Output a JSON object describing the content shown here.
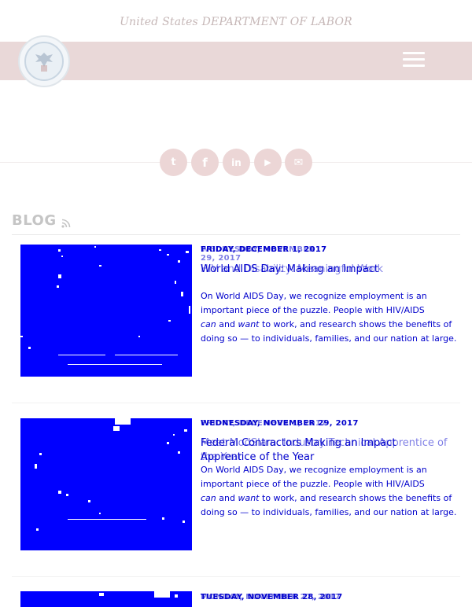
{
  "header": {
    "agency_text": "United States DEPARTMENT OF LABOR"
  },
  "social": [
    {
      "icon": "twitter-icon",
      "glyph": "t"
    },
    {
      "icon": "facebook-icon",
      "glyph": "f"
    },
    {
      "icon": "linkedin-icon",
      "glyph": "in"
    },
    {
      "icon": "youtube-icon",
      "glyph": "▶"
    },
    {
      "icon": "email-icon",
      "glyph": "✉"
    }
  ],
  "blog": {
    "title": "BLOG",
    "posts": [
      {
        "date": "FRIDAY, DECEMBER 1, 2017",
        "date_overlay": "WEDNESDAY, NOVEMBER 29, 2017",
        "title": "World AIDS Day: Making an Impact",
        "title_overlay": "HIV and Disability: Meaningful Work",
        "excerpt_1": "On World AIDS Day, we recognize employment is an important piece of the puzzle. People with HIV/AIDS",
        "excerpt_em1": "can",
        "excerpt_mid": "and",
        "excerpt_em2": "want",
        "excerpt_2": "to work, and research shows the benefits of doing so — to individuals, families, and our nation at large."
      },
      {
        "date": "WEDNESDAY, NOVEMBER 29, 2017",
        "date_overlay": "FRIDAY, DECEMBER 1, 2017",
        "title": "Federal Contractors Making an Impact",
        "title_overlay": "Meet ModSlam: Industry Technical Apprentice of the Year",
        "title_line2": "Apprentice of the Year",
        "excerpt_1": "On World AIDS Day, we recognize employment is an important piece of the puzzle. People with HIV/AIDS",
        "excerpt_em1": "can",
        "excerpt_mid": "and",
        "excerpt_em2": "want",
        "excerpt_2": "to work, and research shows the benefits of doing so — to individuals, families, and our nation at large."
      },
      {
        "date": "TUESDAY, NOVEMBER 28, 2017",
        "date_overlay": "MONDAY, NOVEMBER 27, 2017"
      }
    ]
  },
  "colors": {
    "navbar": "#e9d8d8",
    "social_bg": "#ecd6d6",
    "link": "#0000cc",
    "thumb": "#0000ff"
  }
}
